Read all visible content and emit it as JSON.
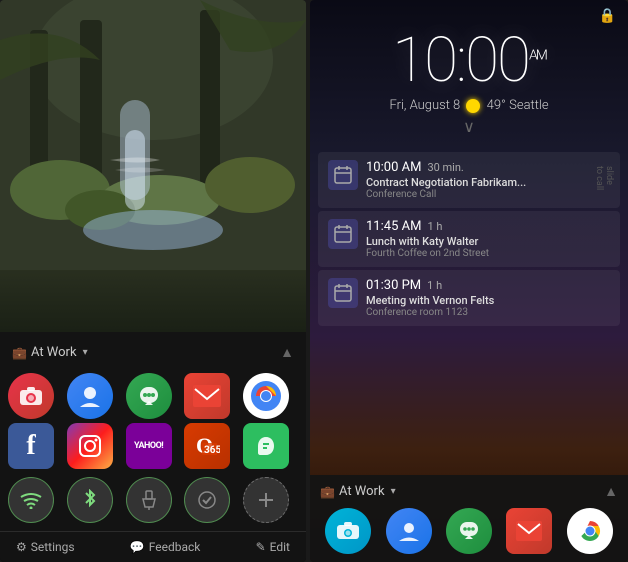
{
  "left": {
    "tray": {
      "title": "At Work",
      "dropdown_label": "▾",
      "chevron": "▲",
      "briefcase": "🎒"
    },
    "apps": [
      {
        "name": "Camera",
        "type": "camera",
        "emoji": "📷"
      },
      {
        "name": "Contacts",
        "type": "contacts",
        "emoji": "👤"
      },
      {
        "name": "Hangouts",
        "type": "hangouts",
        "emoji": "💬"
      },
      {
        "name": "Gmail",
        "type": "gmail",
        "emoji": "✉"
      },
      {
        "name": "Chrome",
        "type": "chrome",
        "emoji": ""
      },
      {
        "name": "Facebook",
        "type": "facebook",
        "emoji": "f"
      },
      {
        "name": "Instagram",
        "type": "instagram",
        "emoji": "📸"
      },
      {
        "name": "Yahoo",
        "type": "yahoo",
        "emoji": "YAHOO!"
      },
      {
        "name": "Office",
        "type": "office",
        "emoji": ""
      },
      {
        "name": "Evernote",
        "type": "evernote",
        "emoji": "🐘"
      }
    ],
    "toggles": [
      {
        "name": "WiFi",
        "icon": "wifi",
        "active": true
      },
      {
        "name": "Bluetooth",
        "icon": "bluetooth",
        "active": true
      },
      {
        "name": "Flashlight",
        "icon": "flashlight",
        "active": false
      },
      {
        "name": "Tasker",
        "icon": "tasker",
        "active": false
      },
      {
        "name": "Add",
        "icon": "add",
        "active": false
      }
    ],
    "footer": [
      {
        "label": "Settings",
        "icon": "⚙"
      },
      {
        "label": "Feedback",
        "icon": "💬"
      },
      {
        "label": "Edit",
        "icon": "✎"
      }
    ]
  },
  "right": {
    "lock": {
      "icon": "🔒",
      "time": "10:00",
      "am_pm": "AM",
      "date": "Fri, August 8",
      "temp": "49°",
      "city": "Seattle",
      "swipe_hint": "∨"
    },
    "notifications": [
      {
        "time": "10:00 AM",
        "duration": "30 min.",
        "title": "Contract Negotiation Fabrikam...",
        "subtitle": "Conference Call",
        "slide_hint": "slide to call"
      },
      {
        "time": "11:45 AM",
        "duration": "1 h",
        "title": "Lunch with Katy Walter",
        "subtitle": "Fourth Coffee on 2nd Street",
        "slide_hint": ""
      },
      {
        "time": "01:30 PM",
        "duration": "1 h",
        "title": "Meeting with Vernon Felts",
        "subtitle": "Conference room 1123",
        "slide_hint": ""
      }
    ],
    "bottom_tray": {
      "title": "At Work",
      "dropdown": "▾",
      "chevron": "▲",
      "apps": [
        {
          "name": "Camera",
          "type": "camera-b"
        },
        {
          "name": "Contacts",
          "type": "contacts-b"
        },
        {
          "name": "Hangouts",
          "type": "hangouts-b"
        },
        {
          "name": "Gmail",
          "type": "gmail-b"
        },
        {
          "name": "Chrome",
          "type": "chrome-b"
        }
      ]
    }
  }
}
